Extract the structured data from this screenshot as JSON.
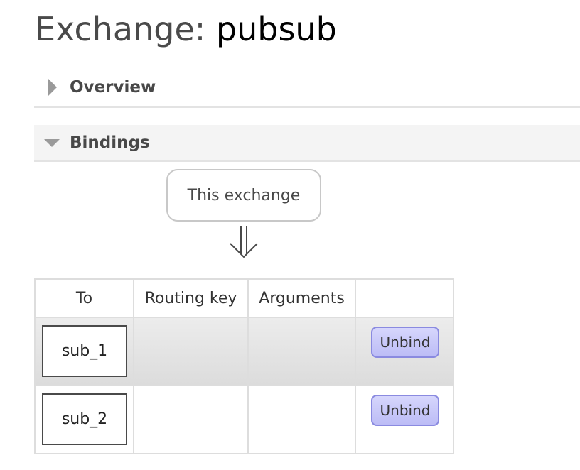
{
  "page": {
    "title_prefix": "Exchange:",
    "exchange_name": "pubsub"
  },
  "sections": {
    "overview": {
      "label": "Overview",
      "expanded": false
    },
    "bindings": {
      "label": "Bindings",
      "expanded": true
    }
  },
  "bindings": {
    "source_label": "This exchange",
    "columns": [
      "To",
      "Routing key",
      "Arguments",
      ""
    ],
    "rows": [
      {
        "to": "sub_1",
        "routing_key": "",
        "arguments": "",
        "action": "Unbind"
      },
      {
        "to": "sub_2",
        "routing_key": "",
        "arguments": "",
        "action": "Unbind"
      }
    ]
  },
  "colors": {
    "button_bg": "#c8c8f8",
    "button_border": "#8a8ae0",
    "text": "#484848"
  },
  "icons": {
    "overview_toggle": "triangle-right-icon",
    "bindings_toggle": "triangle-down-icon",
    "flow_arrow": "double-down-arrow-icon"
  }
}
